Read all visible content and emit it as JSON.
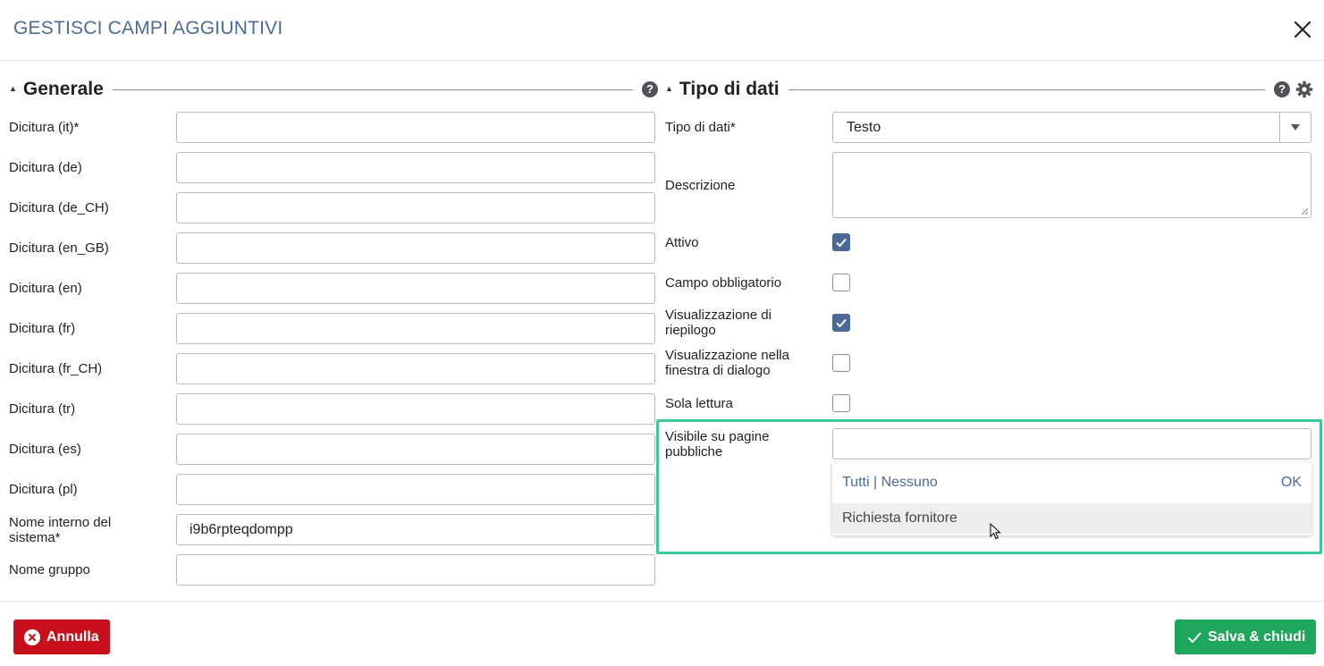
{
  "dialog": {
    "title": "GESTISCI CAMPI AGGIUNTIVI"
  },
  "sections": {
    "general": {
      "title": "Generale"
    },
    "datatype": {
      "title": "Tipo di dati"
    }
  },
  "general_fields": [
    {
      "label": "Dicitura (it)*",
      "value": ""
    },
    {
      "label": "Dicitura (de)",
      "value": ""
    },
    {
      "label": "Dicitura (de_CH)",
      "value": ""
    },
    {
      "label": "Dicitura (en_GB)",
      "value": ""
    },
    {
      "label": "Dicitura (en)",
      "value": ""
    },
    {
      "label": "Dicitura (fr)",
      "value": ""
    },
    {
      "label": "Dicitura (fr_CH)",
      "value": ""
    },
    {
      "label": "Dicitura (tr)",
      "value": ""
    },
    {
      "label": "Dicitura (es)",
      "value": ""
    },
    {
      "label": "Dicitura (pl)",
      "value": ""
    },
    {
      "label": "Nome interno del sistema*",
      "value": "i9b6rpteqdompp"
    },
    {
      "label": "Nome gruppo",
      "value": ""
    }
  ],
  "datatype": {
    "type_label": "Tipo di dati*",
    "type_value": "Testo",
    "description_label": "Descrizione",
    "checkboxes": [
      {
        "label": "Attivo",
        "checked": true
      },
      {
        "label": "Campo obbligatorio",
        "checked": false
      },
      {
        "label": "Visualizzazione di riepilogo",
        "checked": true
      },
      {
        "label": "Visualizzazione nella finestra di dialogo",
        "checked": false
      },
      {
        "label": "Sola lettura",
        "checked": false
      }
    ],
    "public_pages_label": "Visibile su pagine pubbliche",
    "dropdown": {
      "all": "Tutti",
      "separator": "|",
      "none": "Nessuno",
      "ok": "OK",
      "option": "Richiesta fornitore"
    }
  },
  "footer": {
    "cancel_label": "Annulla",
    "save_label": "Salva & chiudi"
  },
  "colors": {
    "title": "#4a6b9a",
    "checkbox_checked": "#4b6896",
    "highlight": "#3fc79d",
    "cancel": "#c8101c",
    "save": "#1ea65c"
  }
}
